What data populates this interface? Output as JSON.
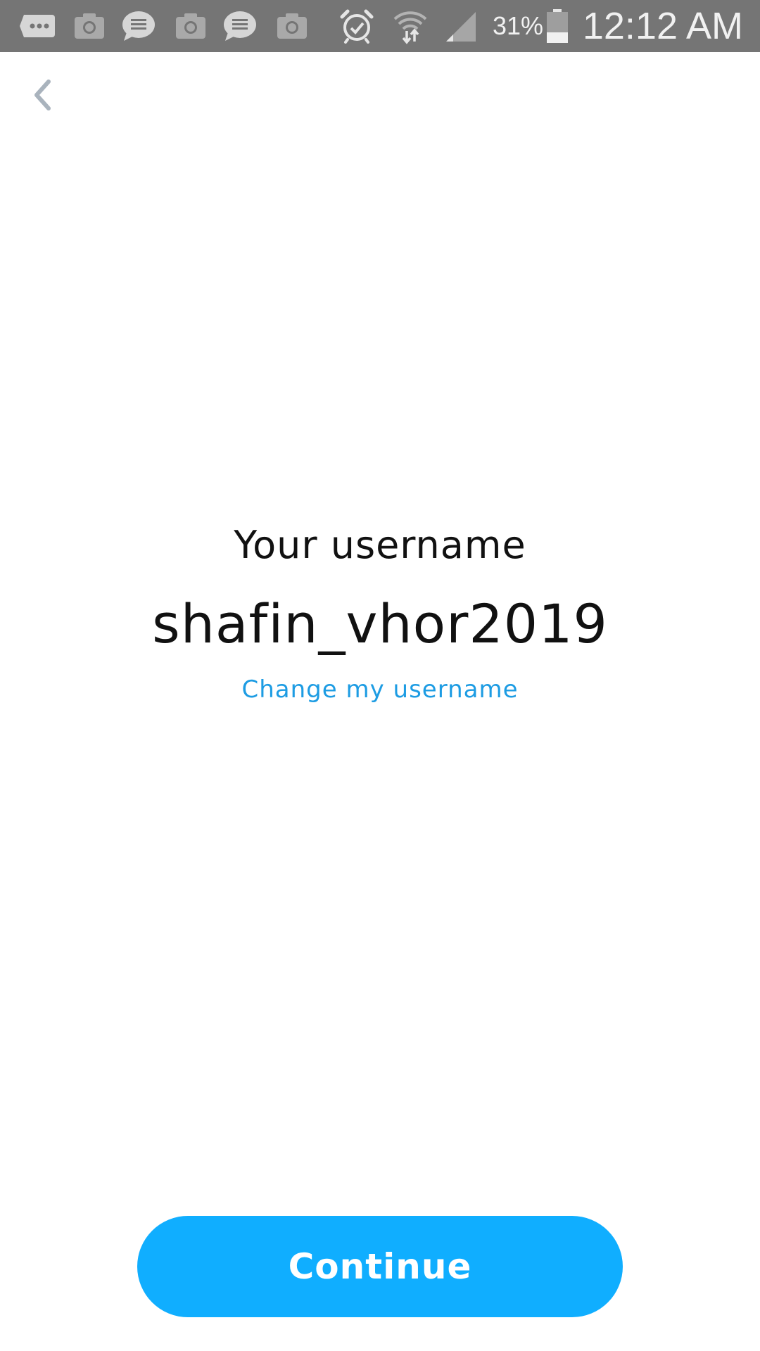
{
  "status_bar": {
    "notification_icons": [
      "more-dots-icon",
      "camera-icon",
      "message-icon",
      "camera-icon",
      "message-icon",
      "camera-icon"
    ],
    "system_icons": [
      "alarm-icon",
      "wifi-icon",
      "signal-icon",
      "battery-icon"
    ],
    "battery_percent": "31%",
    "time": "12:12 AM",
    "background_color": "#757575"
  },
  "navigation": {
    "back_icon": "chevron-left-icon"
  },
  "main": {
    "heading": "Your username",
    "username": "shafin_vhor2019",
    "change_link": "Change my username"
  },
  "footer": {
    "continue_label": "Continue"
  },
  "colors": {
    "accent": "#10aeff",
    "link": "#1d9ce3",
    "text": "#111111"
  }
}
